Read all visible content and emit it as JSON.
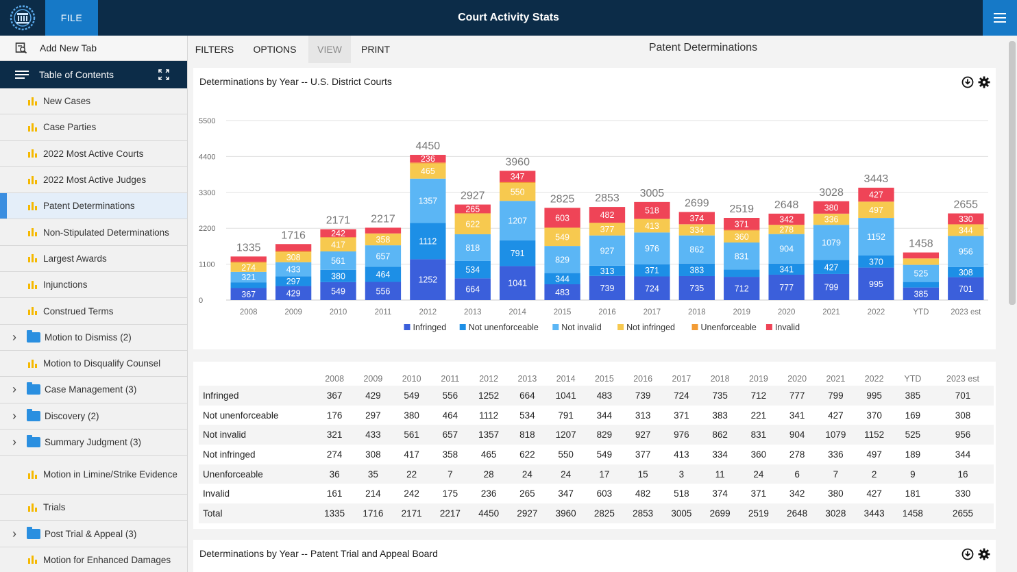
{
  "app": {
    "title": "Court Activity Stats",
    "file_label": "FILE"
  },
  "sidebar": {
    "add_tab": "Add New Tab",
    "toc": "Table of Contents",
    "items": [
      {
        "label": "New Cases",
        "type": "chart"
      },
      {
        "label": "Case Parties",
        "type": "chart"
      },
      {
        "label": "2022 Most Active Courts",
        "type": "chart"
      },
      {
        "label": "2022 Most Active Judges",
        "type": "chart"
      },
      {
        "label": "Patent Determinations",
        "type": "chart",
        "active": true
      },
      {
        "label": "Non-Stipulated Determinations",
        "type": "chart"
      },
      {
        "label": "Largest Awards",
        "type": "chart"
      },
      {
        "label": "Injunctions",
        "type": "chart"
      },
      {
        "label": "Construed Terms",
        "type": "chart"
      },
      {
        "label": "Motion to Dismiss (2)",
        "type": "folder"
      },
      {
        "label": "Motion to Disqualify Counsel",
        "type": "chart"
      },
      {
        "label": "Case Management (3)",
        "type": "folder"
      },
      {
        "label": "Discovery (2)",
        "type": "folder"
      },
      {
        "label": "Summary Judgment (3)",
        "type": "folder"
      },
      {
        "label": "Motion in Limine/Strike Evidence",
        "type": "chart",
        "tall": true
      },
      {
        "label": "Trials",
        "type": "chart"
      },
      {
        "label": "Post Trial & Appeal (3)",
        "type": "folder"
      },
      {
        "label": "Motion for Enhanced Damages",
        "type": "chart"
      }
    ]
  },
  "toolbar": {
    "filters": "FILTERS",
    "options": "OPTIONS",
    "view": "VIEW",
    "print": "PRINT"
  },
  "page_title": "Patent Determinations",
  "chart_card": {
    "title": "Determinations by Year -- U.S. District Courts"
  },
  "ptab_card": {
    "title": "Determinations by Year -- Patent Trial and Appeal Board"
  },
  "colors": {
    "Infringed": "#3b5fdb",
    "Not unenforceable": "#1d8fe6",
    "Not invalid": "#5bb6f5",
    "Not infringed": "#f7c94f",
    "Unenforceable": "#f39c34",
    "Invalid": "#ef4457"
  },
  "chart_data": {
    "type": "bar",
    "stacked": true,
    "title": "Determinations by Year -- U.S. District Courts",
    "categories": [
      "2008",
      "2009",
      "2010",
      "2011",
      "2012",
      "2013",
      "2014",
      "2015",
      "2016",
      "2017",
      "2018",
      "2019",
      "2020",
      "2021",
      "2022",
      "YTD",
      "2023 est"
    ],
    "ylim": [
      0,
      5500
    ],
    "yticks": [
      0,
      1100,
      2200,
      3300,
      4400,
      5500
    ],
    "legend_position": "bottom",
    "series": [
      {
        "name": "Infringed",
        "values": [
          367,
          429,
          549,
          556,
          1252,
          664,
          1041,
          483,
          739,
          724,
          735,
          712,
          777,
          799,
          995,
          385,
          701
        ]
      },
      {
        "name": "Not unenforceable",
        "values": [
          176,
          297,
          380,
          464,
          1112,
          534,
          791,
          344,
          313,
          371,
          383,
          221,
          341,
          427,
          370,
          169,
          308
        ]
      },
      {
        "name": "Not invalid",
        "values": [
          321,
          433,
          561,
          657,
          1357,
          818,
          1207,
          829,
          927,
          976,
          862,
          831,
          904,
          1079,
          1152,
          525,
          956
        ]
      },
      {
        "name": "Not infringed",
        "values": [
          274,
          308,
          417,
          358,
          465,
          622,
          550,
          549,
          377,
          413,
          334,
          360,
          278,
          336,
          497,
          189,
          344
        ]
      },
      {
        "name": "Unenforceable",
        "values": [
          36,
          35,
          22,
          7,
          28,
          24,
          24,
          17,
          15,
          3,
          11,
          24,
          6,
          7,
          2,
          9,
          16
        ]
      },
      {
        "name": "Invalid",
        "values": [
          161,
          214,
          242,
          175,
          236,
          265,
          347,
          603,
          482,
          518,
          374,
          371,
          342,
          380,
          427,
          181,
          330
        ]
      }
    ],
    "totals": [
      1335,
      1716,
      2171,
      2217,
      4450,
      2927,
      3960,
      2825,
      2853,
      3005,
      2699,
      2519,
      2648,
      3028,
      3443,
      1458,
      2655
    ]
  },
  "table": {
    "headers": [
      "2008",
      "2009",
      "2010",
      "2011",
      "2012",
      "2013",
      "2014",
      "2015",
      "2016",
      "2017",
      "2018",
      "2019",
      "2020",
      "2021",
      "2022",
      "YTD",
      "2023 est"
    ],
    "rows": [
      {
        "label": "Infringed",
        "values": [
          "367",
          "429",
          "549",
          "556",
          "1252",
          "664",
          "1041",
          "483",
          "739",
          "724",
          "735",
          "712",
          "777",
          "799",
          "995",
          "385",
          "701"
        ]
      },
      {
        "label": "Not unenforceable",
        "values": [
          "176",
          "297",
          "380",
          "464",
          "1112",
          "534",
          "791",
          "344",
          "313",
          "371",
          "383",
          "221",
          "341",
          "427",
          "370",
          "169",
          "308"
        ]
      },
      {
        "label": "Not invalid",
        "values": [
          "321",
          "433",
          "561",
          "657",
          "1357",
          "818",
          "1207",
          "829",
          "927",
          "976",
          "862",
          "831",
          "904",
          "1079",
          "1152",
          "525",
          "956"
        ]
      },
      {
        "label": "Not infringed",
        "values": [
          "274",
          "308",
          "417",
          "358",
          "465",
          "622",
          "550",
          "549",
          "377",
          "413",
          "334",
          "360",
          "278",
          "336",
          "497",
          "189",
          "344"
        ]
      },
      {
        "label": "Unenforceable",
        "values": [
          "36",
          "35",
          "22",
          "7",
          "28",
          "24",
          "24",
          "17",
          "15",
          "3",
          "11",
          "24",
          "6",
          "7",
          "2",
          "9",
          "16"
        ]
      },
      {
        "label": "Invalid",
        "values": [
          "161",
          "214",
          "242",
          "175",
          "236",
          "265",
          "347",
          "603",
          "482",
          "518",
          "374",
          "371",
          "342",
          "380",
          "427",
          "181",
          "330"
        ]
      },
      {
        "label": "Total",
        "values": [
          "1335",
          "1716",
          "2171",
          "2217",
          "4450",
          "2927",
          "3960",
          "2825",
          "2853",
          "3005",
          "2699",
          "2519",
          "2648",
          "3028",
          "3443",
          "1458",
          "2655"
        ]
      }
    ]
  }
}
